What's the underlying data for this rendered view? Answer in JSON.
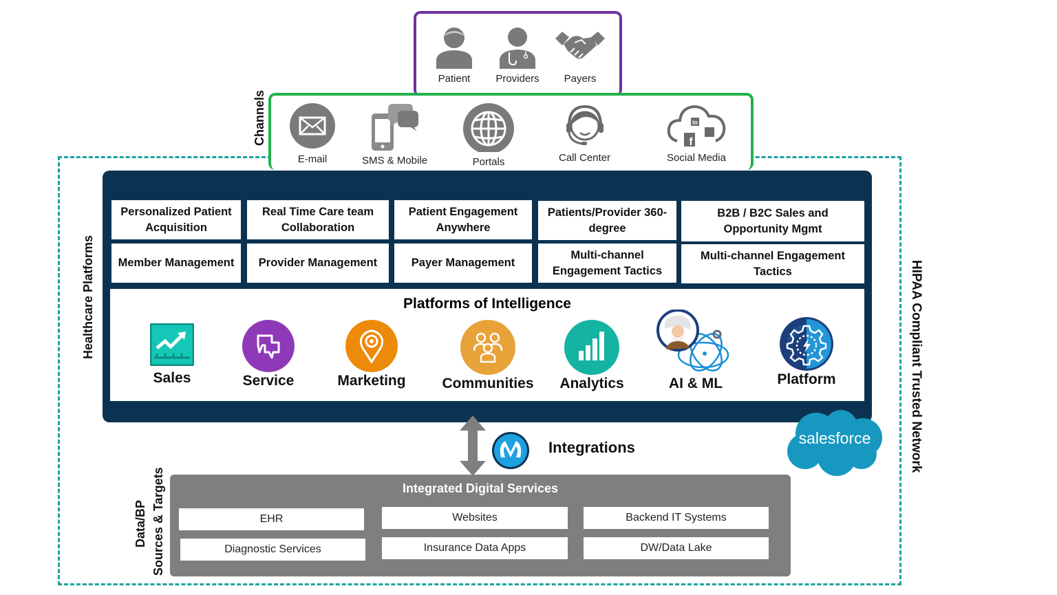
{
  "stakeholders": [
    {
      "label": "Patient",
      "icon": "patient-icon"
    },
    {
      "label": "Providers",
      "icon": "doctor-icon"
    },
    {
      "label": "Payers",
      "icon": "handshake-icon"
    }
  ],
  "channels": {
    "title": "Channels",
    "items": [
      {
        "label": "E-mail",
        "icon": "envelope-icon"
      },
      {
        "label": "SMS & Mobile",
        "icon": "mobile-chat-icon"
      },
      {
        "label": "Portals",
        "icon": "globe-icon"
      },
      {
        "label": "Call Center",
        "icon": "headset-icon"
      },
      {
        "label": "Social Media",
        "icon": "social-cloud-icon"
      }
    ]
  },
  "healthcare_platforms": {
    "title": "Healthcare Platforms",
    "capabilities": [
      [
        "Personalized Patient Acquisition",
        "Real Time Care team Collaboration",
        "Patient Engagement Anywhere",
        "Patients/Provider 360-degree",
        "B2B / B2C Sales and Opportunity Mgmt"
      ],
      [
        "Member Management",
        "Provider Management",
        "Payer Management",
        "Multi-channel Engagement Tactics",
        "Multi-channel Engagement Tactics"
      ]
    ],
    "intelligence": {
      "title": "Platforms of Intelligence",
      "tiles": [
        {
          "label": "Sales",
          "icon": "sales-chart-icon",
          "color": "#14c7b6"
        },
        {
          "label": "Service",
          "icon": "chat-bubbles-icon",
          "color": "#8e3ab8"
        },
        {
          "label": "Marketing",
          "icon": "location-pin-icon",
          "color": "#ee8a0a"
        },
        {
          "label": "Communities",
          "icon": "people-group-icon",
          "color": "#e8a23a"
        },
        {
          "label": "Analytics",
          "icon": "bar-chart-icon",
          "color": "#14b3a2"
        },
        {
          "label": "AI  & ML",
          "icon": "einstein-ai-icon",
          "color": "#1a8fd6"
        },
        {
          "label": "Platform",
          "icon": "gear-lightning-icon",
          "color": "#1b4f99"
        }
      ]
    }
  },
  "integrations": {
    "label": "Integrations",
    "icon": "mulesoft-icon"
  },
  "brand": {
    "label": "salesforce",
    "color": "#1798c1"
  },
  "network_label": "HIPAA Compliant Trusted  Network",
  "data_sources": {
    "title_line1": "Data/BP",
    "title_line2": "Sources & Targets",
    "panel_title": "Integrated Digital Services",
    "services": [
      [
        "EHR",
        "Websites",
        "Backend  IT Systems"
      ],
      [
        "Diagnostic Services",
        "Insurance Data Apps",
        "DW/Data Lake"
      ]
    ]
  },
  "colors": {
    "network_border": "#1aa39c",
    "stakeholder_border": "#7030a0",
    "channel_border": "#21b14c",
    "platform_panel": "#0b3351",
    "services_panel": "#7f7f7f",
    "icon_gray": "#7a7a7a"
  }
}
